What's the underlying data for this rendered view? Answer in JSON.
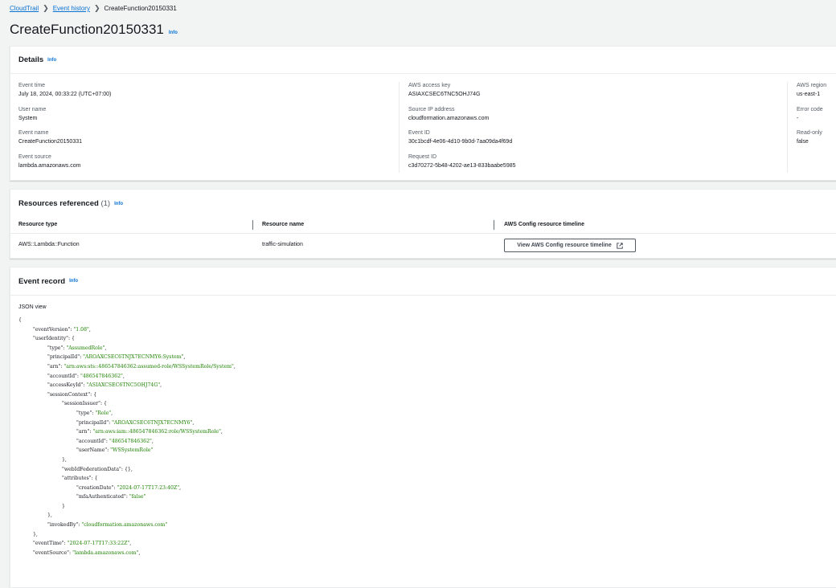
{
  "breadcrumb": {
    "root": "CloudTrail",
    "parent": "Event history",
    "current": "CreateFunction20150331"
  },
  "page": {
    "title": "CreateFunction20150331",
    "info": "Info"
  },
  "details": {
    "heading": "Details",
    "info": "Info",
    "col1": [
      {
        "label": "Event time",
        "value": "July 18, 2024, 00:33:22 (UTC+07:00)"
      },
      {
        "label": "User name",
        "value": "System"
      },
      {
        "label": "Event name",
        "value": "CreateFunction20150331"
      },
      {
        "label": "Event source",
        "value": "lambda.amazonaws.com"
      }
    ],
    "col2": [
      {
        "label": "AWS access key",
        "value": "ASIAXCSEC6TNC5OHJ74G"
      },
      {
        "label": "Source IP address",
        "value": "cloudformation.amazonaws.com"
      },
      {
        "label": "Event ID",
        "value": "30c1bcdf-4e06-4d10-9b0d-7aa09da4f69d"
      },
      {
        "label": "Request ID",
        "value": "c3d70272-5b48-4202-ae13-833baabe5985"
      }
    ],
    "col3": [
      {
        "label": "AWS region",
        "value": "us-east-1"
      },
      {
        "label": "Error code",
        "value": "-"
      },
      {
        "label": "Read-only",
        "value": "false"
      }
    ]
  },
  "resources": {
    "heading": "Resources referenced",
    "count": "(1)",
    "info": "Info",
    "columns": [
      "Resource type",
      "Resource name",
      "AWS Config resource timeline"
    ],
    "row": {
      "type": "AWS::Lambda::Function",
      "name": "traffic-simulation",
      "button": "View AWS Config resource timeline"
    }
  },
  "record": {
    "heading": "Event record",
    "info": "Info",
    "view_label": "JSON view",
    "lines": [
      {
        "i": 0,
        "t": "{"
      },
      {
        "i": 1,
        "k": "\"eventVersion\"",
        "s": "\"1.08\"",
        "e": ","
      },
      {
        "i": 1,
        "k": "\"userIdentity\"",
        "t": ": {"
      },
      {
        "i": 2,
        "k": "\"type\"",
        "s": "\"AssumedRole\"",
        "e": ","
      },
      {
        "i": 2,
        "k": "\"principalId\"",
        "s": "\"AROAXCSEC6TNJX7ECNMY6:System\"",
        "e": ","
      },
      {
        "i": 2,
        "k": "\"arn\"",
        "s": "\"arn:aws:sts::486547846362:assumed-role/WSSystemRole/System\"",
        "e": ","
      },
      {
        "i": 2,
        "k": "\"accountId\"",
        "s": "\"486547846362\"",
        "e": ","
      },
      {
        "i": 2,
        "k": "\"accessKeyId\"",
        "s": "\"ASIAXCSEC6TNC5OHJ74G\"",
        "e": ","
      },
      {
        "i": 2,
        "k": "\"sessionContext\"",
        "t": ": {"
      },
      {
        "i": 3,
        "k": "\"sessionIssuer\"",
        "t": ": {"
      },
      {
        "i": 4,
        "k": "\"type\"",
        "s": "\"Role\"",
        "e": ","
      },
      {
        "i": 4,
        "k": "\"principalId\"",
        "s": "\"AROAXCSEC6TNJX7ECNMY6\"",
        "e": ","
      },
      {
        "i": 4,
        "k": "\"arn\"",
        "s": "\"arn:aws:iam::486547846362:role/WSSystemRole\"",
        "e": ","
      },
      {
        "i": 4,
        "k": "\"accountId\"",
        "s": "\"486547846362\"",
        "e": ","
      },
      {
        "i": 4,
        "k": "\"userName\"",
        "s": "\"WSSystemRole\""
      },
      {
        "i": 3,
        "t": "},"
      },
      {
        "i": 3,
        "k": "\"webIdFederationData\"",
        "t": ": {},"
      },
      {
        "i": 3,
        "k": "\"attributes\"",
        "t": ": {"
      },
      {
        "i": 4,
        "k": "\"creationDate\"",
        "s": "\"2024-07-17T17:23:40Z\"",
        "e": ","
      },
      {
        "i": 4,
        "k": "\"mfaAuthenticated\"",
        "s": "\"false\""
      },
      {
        "i": 3,
        "t": "}"
      },
      {
        "i": 2,
        "t": "},"
      },
      {
        "i": 2,
        "k": "\"invokedBy\"",
        "s": "\"cloudformation.amazonaws.com\""
      },
      {
        "i": 1,
        "t": "},"
      },
      {
        "i": 1,
        "k": "\"eventTime\"",
        "s": "\"2024-07-17T17:33:22Z\"",
        "e": ","
      },
      {
        "i": 1,
        "k": "\"eventSource\"",
        "s": "\"lambda.amazonaws.com\"",
        "e": ","
      }
    ]
  },
  "colors": {
    "link": "#0972d3",
    "string": "#1d8102"
  }
}
